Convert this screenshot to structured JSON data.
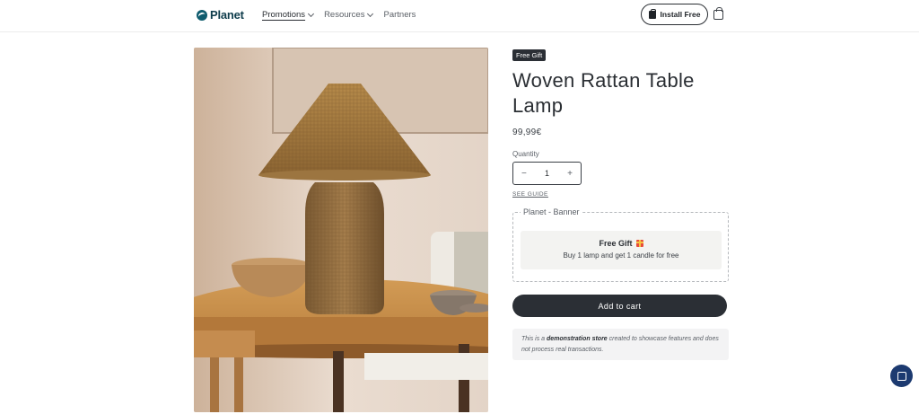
{
  "header": {
    "logo_text": "Planet",
    "nav": [
      {
        "label": "Promotions",
        "has_dropdown": true,
        "active": true
      },
      {
        "label": "Resources",
        "has_dropdown": true,
        "active": false
      },
      {
        "label": "Partners",
        "has_dropdown": false,
        "active": false
      }
    ],
    "install_label": "Install Free"
  },
  "product": {
    "badge": "Free Gift",
    "title": "Woven Rattan Table Lamp",
    "price": "99,99€",
    "quantity_label": "Quantity",
    "quantity_value": "1",
    "decrement_label": "−",
    "increment_label": "+",
    "guide_link": "SEE GUIDE"
  },
  "banner": {
    "legend": "Planet - Banner",
    "gift_title": "Free Gift",
    "gift_desc": "Buy 1 lamp and get 1 candle for free"
  },
  "cart": {
    "add_label": "Add to cart"
  },
  "demo_note": {
    "prefix": "This is a ",
    "strong": "demonstration store",
    "suffix": " created to showcase features and does not process real transactions."
  },
  "colors": {
    "brand": "#0f5c6e",
    "button_dark": "#2b2f35",
    "chat": "#1c3a70"
  }
}
